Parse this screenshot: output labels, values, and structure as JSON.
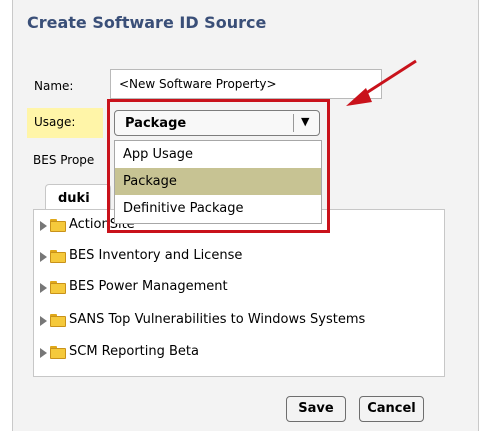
{
  "dialog": {
    "title": "Create Software ID Source",
    "name_label": "Name:",
    "name_value": "<New Software Property>",
    "usage_label": "Usage:",
    "usage_selected": "Package",
    "bes_label": "BES Prope",
    "usage_options": [
      "App Usage",
      "Package",
      "Definitive Package"
    ],
    "tab_label": "duki",
    "tree_items": [
      "ActionSite",
      "BES Inventory and License",
      "BES Power Management",
      "SANS Top Vulnerabilities to Windows Systems",
      "SCM Reporting Beta"
    ],
    "save_label": "Save",
    "cancel_label": "Cancel"
  },
  "colors": {
    "title": "#3a4f78",
    "usage_highlight": "#fff5a8",
    "selected_option": "#c7c393",
    "annotation_red": "#c9121b"
  },
  "icons": {
    "dropdown": "chevron-down-icon",
    "tree_expand": "triangle-right-icon",
    "folder": "folder-icon"
  }
}
